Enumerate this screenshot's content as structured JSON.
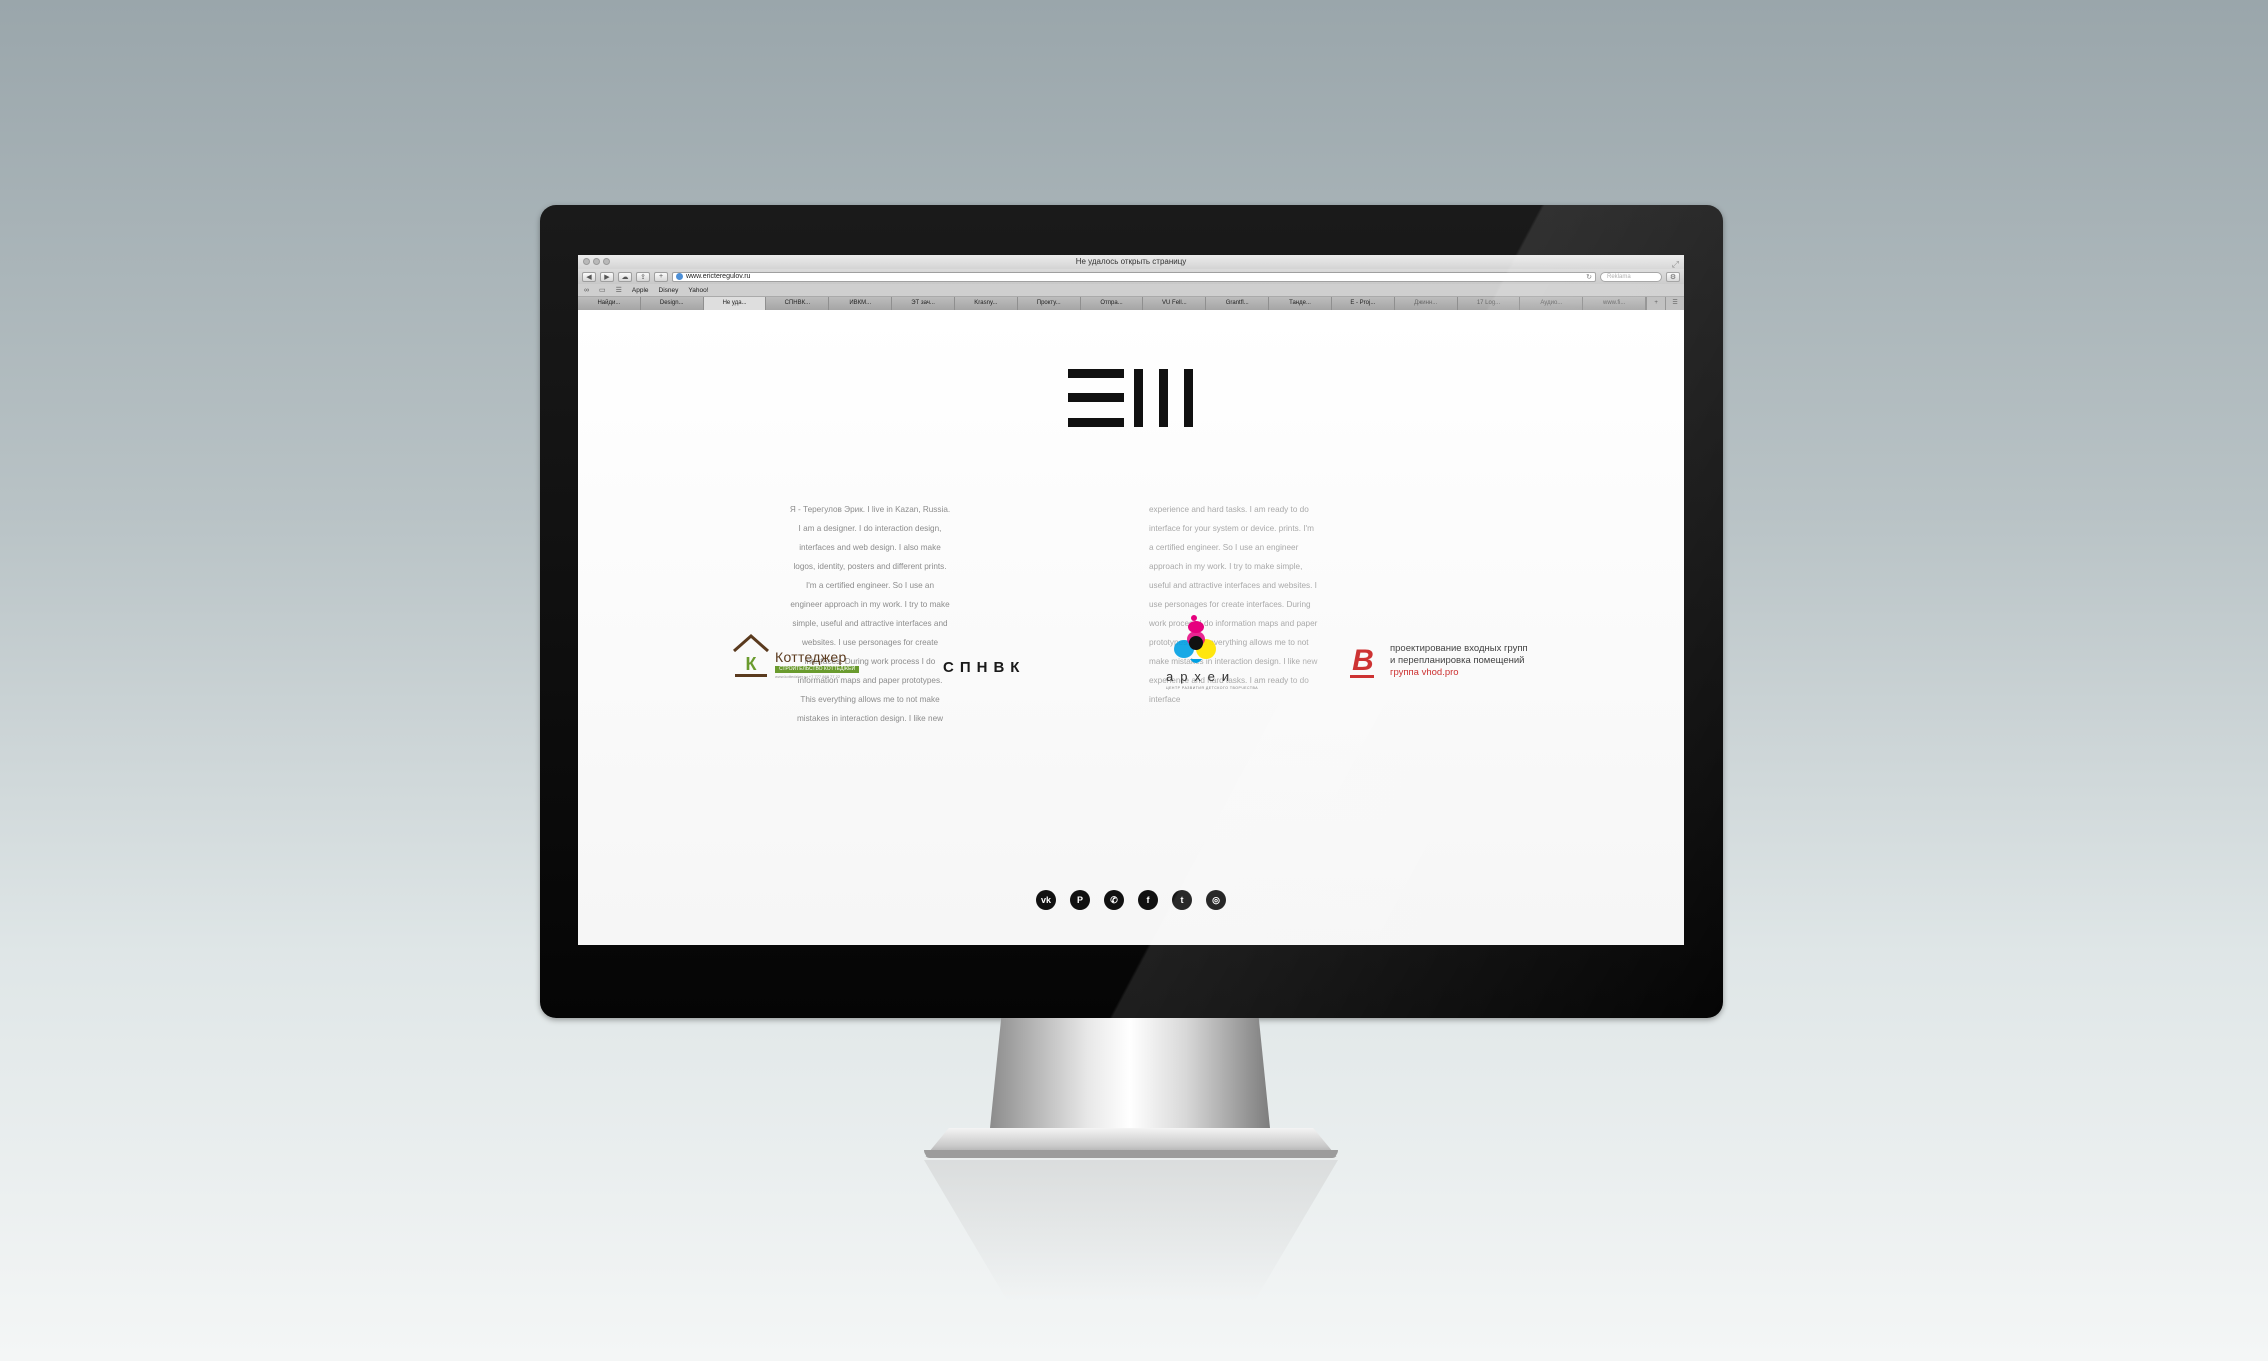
{
  "browser": {
    "window_title": "Не удалось открыть страницу",
    "url": "www.ericteregulov.ru",
    "search_placeholder": "Reklama",
    "bookmarks": [
      "Apple",
      "Disney",
      "Yahoo!"
    ],
    "tabs": [
      {
        "label": "Найди..."
      },
      {
        "label": "Design..."
      },
      {
        "label": "Не уда..."
      },
      {
        "label": "СПНВК..."
      },
      {
        "label": "ИВКМ..."
      },
      {
        "label": "ЭТ зач..."
      },
      {
        "label": "Krasny..."
      },
      {
        "label": "Прокту..."
      },
      {
        "label": "Отпра..."
      },
      {
        "label": "VU Fell..."
      },
      {
        "label": "Grantfl..."
      },
      {
        "label": "Танде..."
      },
      {
        "label": "E - Proj..."
      },
      {
        "label": "Джинн..."
      },
      {
        "label": "17 Log..."
      },
      {
        "label": "Аудио..."
      },
      {
        "label": "www.fi..."
      }
    ],
    "new_tab_label": "+"
  },
  "page": {
    "bio_left": "Я - Терегулов Эрик. I live in Kazan, Russia. I am a de­signer. I do interaction design, interfaces and web design. I also make logos, identity, posters and different prints. I'm a certified engineer. So I use an engineer ap­proach in my work. I try to make simple, useful and at­tractive interfaces and websites. I use personages for create interfaces. During work process I do information maps and paper prototypes. This everything allows me to not make mistakes in interaction design. I like new",
    "bio_right": "experience and hard tasks. I am ready to do interface for your system or device. prints. I'm a certified engi­neer. So I use an engineer approach in my work. I try to make simple, useful and attractive interfaces and web­sites. I use personages for create interfaces. During work process I do information maps and paper proto­types. This everything allows me to not make mistakes in interaction design. I like new experience and hard tasks. I am ready to do interface"
  },
  "clients": {
    "kottedzher": {
      "letter": "К",
      "name": "Коттеджер",
      "tagline": "СТРОИТЕЛЬСТВО КОТТЕДЖЕЙ",
      "sub": "www.kottedzher.ru  +7 777 888 77 22"
    },
    "spnvk": {
      "name": "СПНВК"
    },
    "arhei": {
      "name": "археи",
      "sub": "ЦЕНТР РАЗВИТИЯ ДЕТСКОГО ТВОРЧЕСТВА"
    },
    "vhod": {
      "letter": "B",
      "line1": "проектирование входных групп",
      "line2": "и перепланировка помещений",
      "link": "группа vhod.pro"
    }
  },
  "social": [
    {
      "name": "vk-icon",
      "glyph": "vk"
    },
    {
      "name": "pinterest-icon",
      "glyph": "P"
    },
    {
      "name": "whatsapp-icon",
      "glyph": "✆"
    },
    {
      "name": "facebook-icon",
      "glyph": "f"
    },
    {
      "name": "twitter-icon",
      "glyph": "t"
    },
    {
      "name": "instagram-icon",
      "glyph": "◎"
    }
  ],
  "colors": {
    "kottedzher_green": "#6a9b2e",
    "kottedzher_brown": "#5a3a1e",
    "vhod_red": "#c81e1e",
    "arhei_magenta": "#e6007e",
    "arhei_cyan": "#00a0e3",
    "arhei_yellow": "#ffe500"
  }
}
